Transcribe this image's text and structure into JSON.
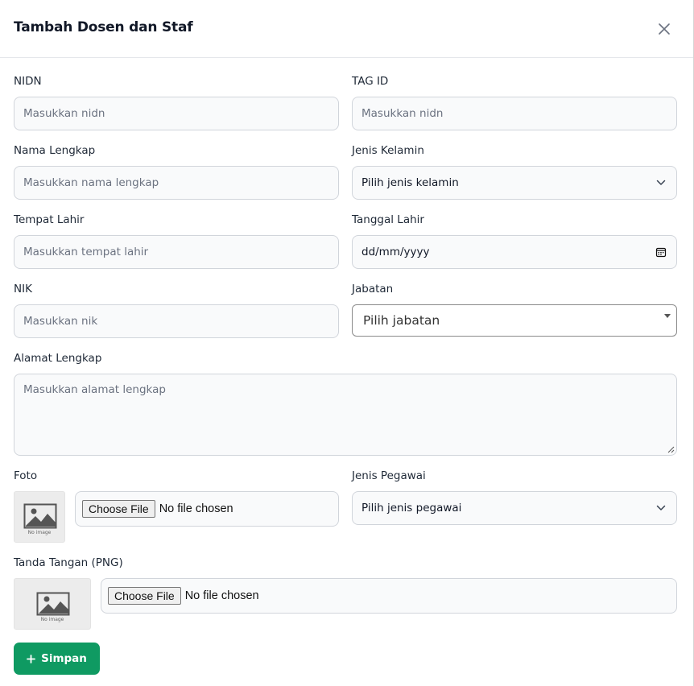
{
  "modal": {
    "title": "Tambah Dosen dan Staf"
  },
  "fields": {
    "nidn": {
      "label": "NIDN",
      "placeholder": "Masukkan nidn"
    },
    "tag_id": {
      "label": "TAG ID",
      "placeholder": "Masukkan nidn"
    },
    "nama": {
      "label": "Nama Lengkap",
      "placeholder": "Masukkan nama lengkap"
    },
    "jenis_kelamin": {
      "label": "Jenis Kelamin",
      "value": "Pilih jenis kelamin"
    },
    "tempat_lahir": {
      "label": "Tempat Lahir",
      "placeholder": "Masukkan tempat lahir"
    },
    "tanggal_lahir": {
      "label": "Tanggal Lahir",
      "value": "dd/mm/yyyy"
    },
    "nik": {
      "label": "NIK",
      "placeholder": "Masukkan nik"
    },
    "jabatan": {
      "label": "Jabatan",
      "value": "Pilih jabatan"
    },
    "alamat": {
      "label": "Alamat Lengkap",
      "placeholder": "Masukkan alamat lengkap"
    },
    "foto": {
      "label": "Foto",
      "button": "Choose File",
      "status": "No file chosen",
      "thumb_text": "No image"
    },
    "jenis_pegawai": {
      "label": "Jenis Pegawai",
      "value": "Pilih jenis pegawai"
    },
    "tanda_tangan": {
      "label": "Tanda Tangan (PNG)",
      "button": "Choose File",
      "status": "No file chosen",
      "thumb_text": "No image"
    }
  },
  "actions": {
    "save_label": "Simpan",
    "save_color": "#0f9a62"
  },
  "icons": {
    "close": "close-icon",
    "chevron": "chevron-down-icon",
    "calendar": "calendar-icon",
    "image": "image-placeholder-icon",
    "plus": "plus-icon"
  }
}
